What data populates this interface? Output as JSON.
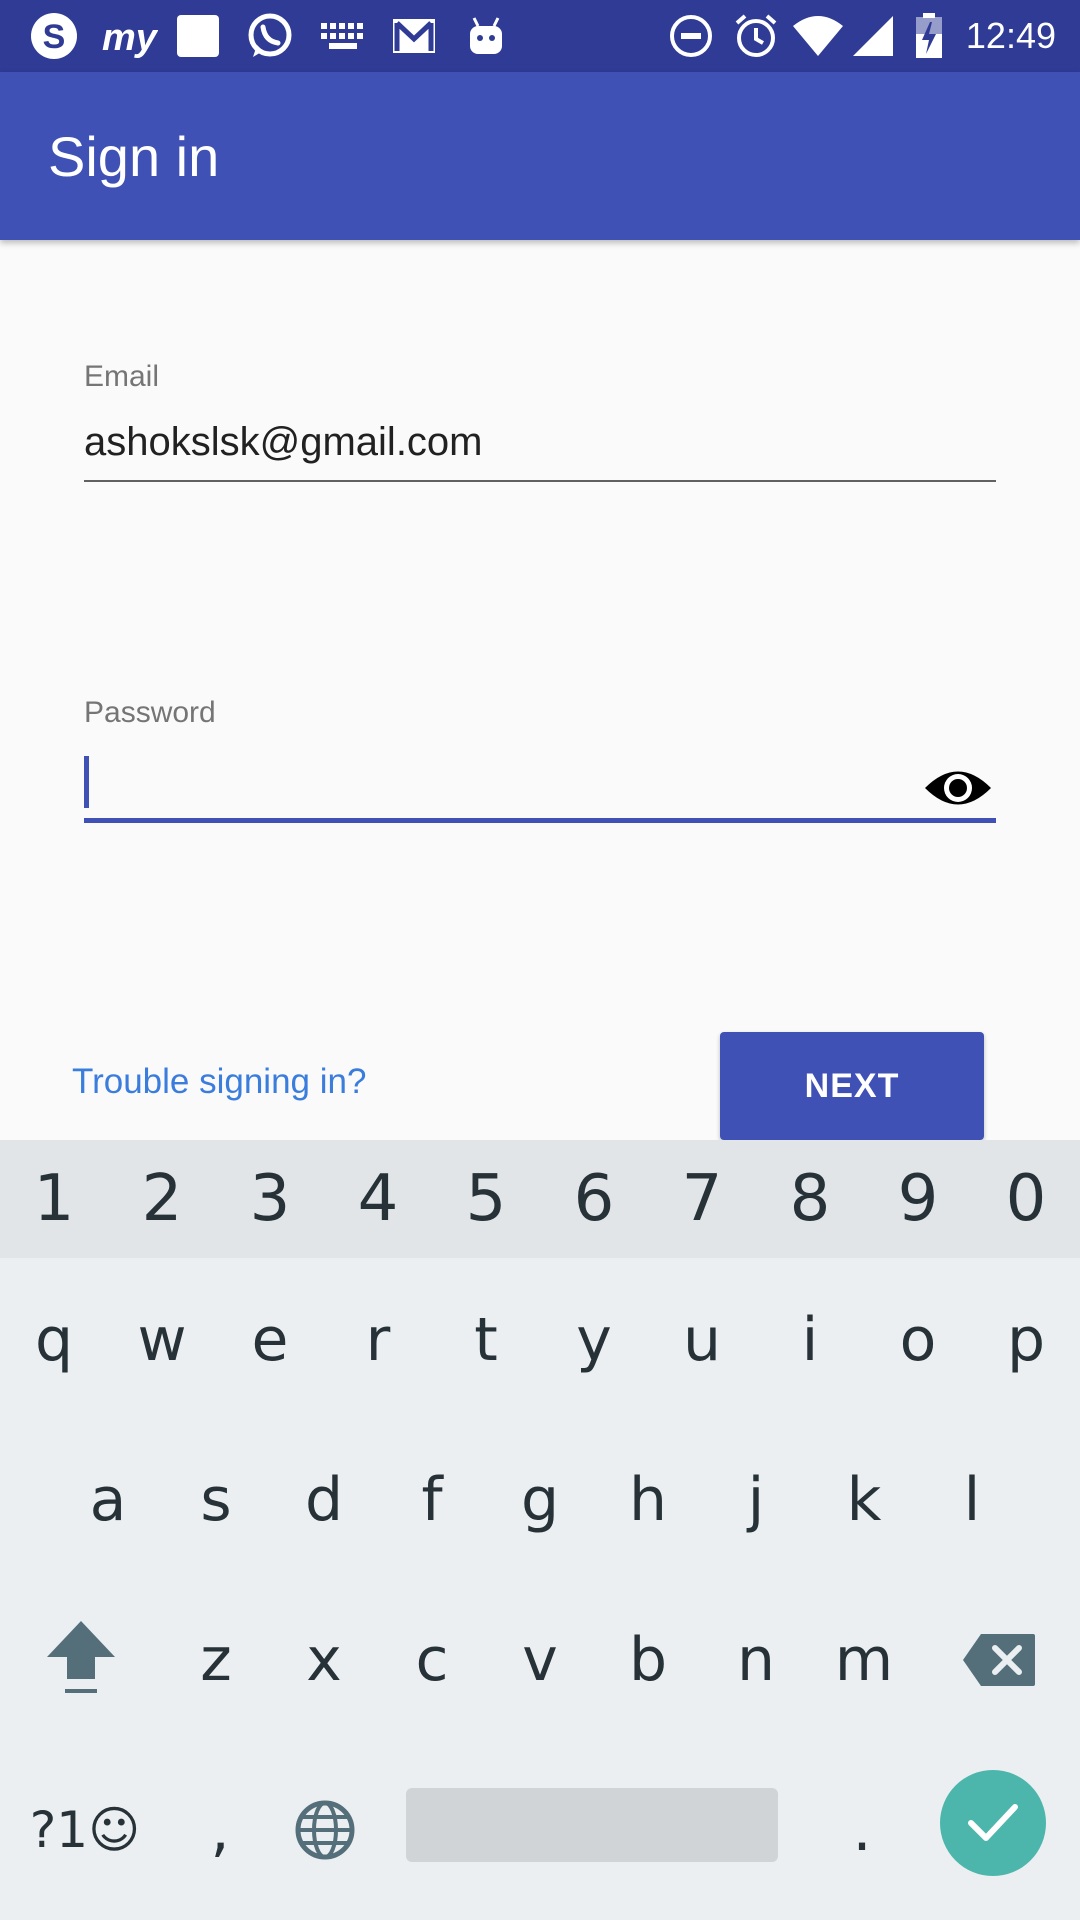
{
  "status_bar": {
    "time": "12:49",
    "left_icons": [
      "skype-icon",
      "myntra-icon",
      "square-notification-icon",
      "whatsapp-icon",
      "keyboard-icon",
      "gmail-icon",
      "android-robot-icon"
    ],
    "right_icons": [
      "do-not-disturb-icon",
      "alarm-icon",
      "wifi-icon",
      "cell-signal-icon",
      "battery-icon"
    ]
  },
  "app_bar": {
    "title": "Sign in"
  },
  "form": {
    "email_label": "Email",
    "email_value": "ashokslsk@gmail.com",
    "password_label": "Password",
    "password_value": ""
  },
  "actions": {
    "trouble_link": "Trouble signing in?",
    "next_button": "NEXT"
  },
  "keyboard": {
    "number_row": [
      "1",
      "2",
      "3",
      "4",
      "5",
      "6",
      "7",
      "8",
      "9",
      "0"
    ],
    "row1": [
      "q",
      "w",
      "e",
      "r",
      "t",
      "y",
      "u",
      "i",
      "o",
      "p"
    ],
    "row2": [
      "a",
      "s",
      "d",
      "f",
      "g",
      "h",
      "j",
      "k",
      "l"
    ],
    "row3": [
      "z",
      "x",
      "c",
      "v",
      "b",
      "n",
      "m"
    ],
    "symbols_key": "?1☺",
    "comma_key": ",",
    "period_key": "."
  },
  "colors": {
    "status_bar": "#2f3b95",
    "primary": "#3f51b5",
    "link": "#3b7ddd",
    "enter_key": "#4db6ac"
  }
}
